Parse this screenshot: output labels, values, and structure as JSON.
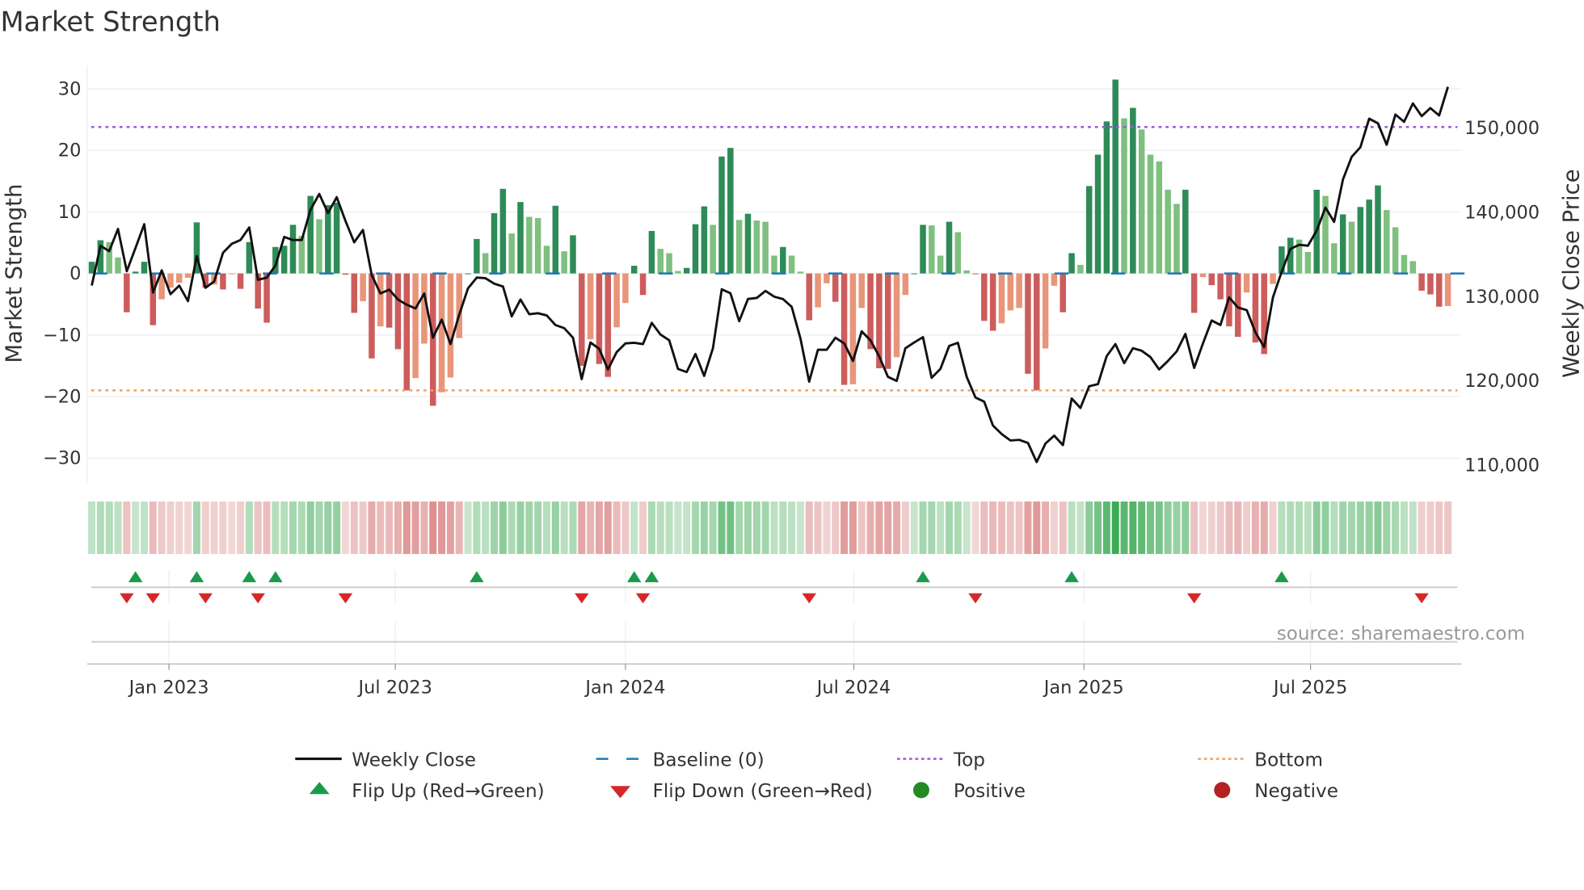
{
  "title": "Market Strength",
  "source": "source: sharemaestro.com",
  "colors": {
    "pos_dark": "#2e8b57",
    "pos_light": "#7fbf7f",
    "neg_dark": "#cd5c5c",
    "neg_light": "#e8957a",
    "line": "#111111",
    "baseline": "#1f77b4",
    "top": "#9b59e0",
    "bottom": "#f0a060",
    "flip_up": "#1a9a4a",
    "flip_down": "#d62728",
    "positive": "#228b22",
    "negative": "#b22222"
  },
  "legend": [
    {
      "key": "close",
      "label": "Weekly Close"
    },
    {
      "key": "baseline",
      "label": "Baseline (0)"
    },
    {
      "key": "top",
      "label": "Top"
    },
    {
      "key": "bottom",
      "label": "Bottom"
    },
    {
      "key": "flip_up",
      "label": "Flip Up (Red→Green)"
    },
    {
      "key": "flip_down",
      "label": "Flip Down (Green→Red)"
    },
    {
      "key": "positive",
      "label": "Positive"
    },
    {
      "key": "negative",
      "label": "Negative"
    }
  ],
  "chart_data": {
    "type": "bar",
    "title": "Market Strength",
    "ylabel": "Market Strength",
    "y2label": "Weekly Close Price",
    "ylim": [
      -34,
      34
    ],
    "y2lim": [
      105000,
      159000
    ],
    "y_ticks": [
      "30",
      "20",
      "10",
      "0",
      "−10",
      "−20",
      "−30"
    ],
    "y_tick_values": [
      30,
      20,
      10,
      0,
      -10,
      -20,
      -30
    ],
    "y2_ticks": [
      "150,000",
      "140,000",
      "130,000",
      "120,000",
      "110,000"
    ],
    "y2_tick_values": [
      150000,
      140000,
      130000,
      120000,
      110000
    ],
    "top_threshold": 23.8,
    "bottom_threshold": -19,
    "baseline": 0,
    "x_ticks": [
      {
        "label": "Jan 2023",
        "week": 8.83
      },
      {
        "label": "Jul 2023",
        "week": 34.7
      },
      {
        "label": "Jan 2024",
        "week": 61.0
      },
      {
        "label": "Jul 2024",
        "week": 87.1
      },
      {
        "label": "Jan 2025",
        "week": 113.4
      },
      {
        "label": "Jul 2025",
        "week": 139.3
      }
    ],
    "strength": [
      1.9,
      5.4,
      5.1,
      2.6,
      -6.3,
      0.3,
      1.9,
      -8.4,
      -4.2,
      -2.3,
      -1.5,
      -0.7,
      8.3,
      -2.3,
      -1.8,
      -2.6,
      -0.1,
      -2.5,
      5.1,
      -5.7,
      -8.0,
      4.3,
      4.5,
      7.9,
      6.1,
      12.6,
      8.8,
      11.1,
      11.5,
      -0.2,
      -6.4,
      -4.5,
      -13.8,
      -8.6,
      -8.8,
      -12.3,
      -19.0,
      -17.0,
      -11.4,
      -21.5,
      -19.3,
      -16.9,
      -10.5,
      0,
      5.6,
      3.3,
      9.8,
      13.75,
      6.5,
      11.6,
      9.2,
      9.0,
      4.5,
      11.0,
      3.6,
      6.2,
      -15.0,
      -10.7,
      -14.7,
      -16.8,
      -8.75,
      -4.8,
      1.25,
      -3.5,
      6.9,
      4.0,
      3.3,
      0.4,
      0.9,
      8.0,
      10.9,
      7.9,
      19.0,
      20.4,
      8.7,
      9.7,
      8.6,
      8.4,
      2.9,
      4.3,
      2.9,
      0.3,
      -7.6,
      -5.5,
      -1.6,
      -4.6,
      -18.1,
      -18.0,
      -5.6,
      -12.3,
      -15.4,
      -15.5,
      -13.6,
      -3.5,
      0,
      7.9,
      7.8,
      2.9,
      8.4,
      6.7,
      0.5,
      -0.1,
      -7.7,
      -9.3,
      -8.1,
      -6.0,
      -5.6,
      -16.3,
      -19.0,
      -12.2,
      -2.0,
      -6.3,
      3.3,
      1.4,
      14.2,
      19.3,
      24.7,
      31.5,
      25.2,
      26.9,
      23.4,
      19.3,
      18.2,
      13.6,
      11.3,
      13.6,
      -6.4,
      -0.6,
      -1.9,
      -4.2,
      -8.6,
      -10.3,
      -3.1,
      -11.2,
      -13.1,
      -1.7,
      4.4,
      5.8,
      5.5,
      3.5,
      13.6,
      12.6,
      4.9,
      9.6,
      8.4,
      10.8,
      12.0,
      14.3,
      10.3,
      7.5,
      3.0,
      2.0,
      -2.8,
      -3.4,
      -5.4,
      -5.3
    ],
    "close": [
      131320,
      136040,
      135400,
      138040,
      133020,
      135770,
      138600,
      130490,
      133130,
      130300,
      131320,
      129470,
      134830,
      131050,
      131810,
      135210,
      136260,
      136720,
      138220,
      132000,
      132260,
      133700,
      137090,
      136720,
      136720,
      140300,
      142190,
      139920,
      141810,
      138980,
      136450,
      137920,
      132560,
      130380,
      130830,
      129660,
      129050,
      128600,
      130380,
      125130,
      127280,
      124370,
      127850,
      130980,
      132260,
      132190,
      131550,
      131210,
      127660,
      129660,
      127920,
      128040,
      127770,
      126640,
      126260,
      125130,
      120220,
      124560,
      123810,
      121360,
      123430,
      124450,
      124530,
      124370,
      126900,
      125510,
      124830,
      121430,
      121050,
      123200,
      120600,
      123880,
      130870,
      130410,
      127090,
      129730,
      129850,
      130680,
      130000,
      129730,
      128790,
      125020,
      119920,
      123700,
      123700,
      125130,
      124450,
      122370,
      125880,
      124830,
      122940,
      120490,
      120000,
      123880,
      124560,
      125200,
      120370,
      121430,
      124150,
      124530,
      120490,
      118030,
      117540,
      114710,
      113690,
      112940,
      113010,
      112640,
      110370,
      112560,
      113510,
      112380,
      117920,
      116790,
      119360,
      119620,
      122940,
      124370,
      122110,
      123880,
      123580,
      122830,
      121360,
      122370,
      123510,
      125580,
      121540,
      124450,
      127170,
      126640,
      129920,
      128720,
      128410,
      125770,
      124000,
      129920,
      132940,
      135660,
      136150,
      136040,
      137850,
      140570,
      138870,
      143890,
      146600,
      147740,
      151130,
      150570,
      148040,
      151620,
      150750,
      152940,
      151430,
      152380,
      151510,
      154900
    ]
  }
}
